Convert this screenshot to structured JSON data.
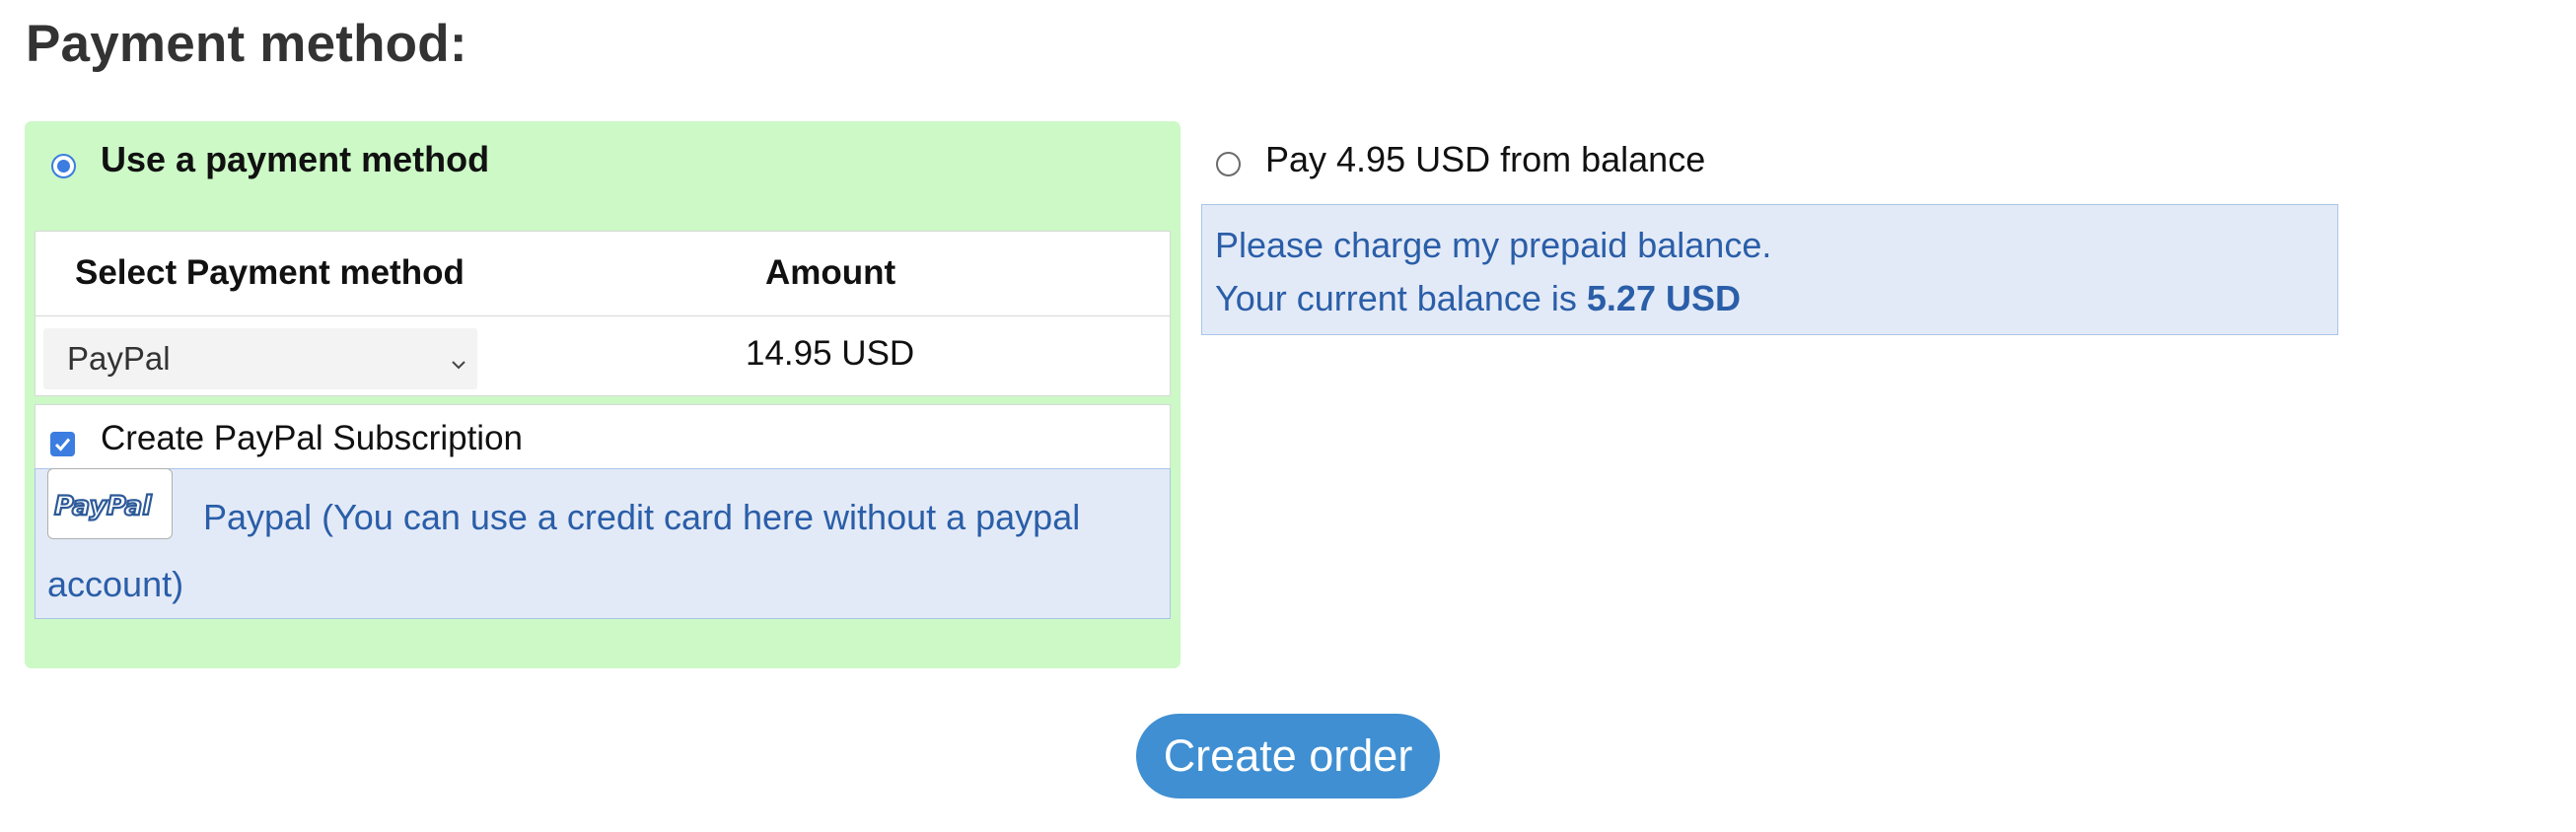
{
  "page": {
    "title": "Payment method:"
  },
  "payment_option": {
    "label": "Use a payment method",
    "selected": true
  },
  "method_table": {
    "header_method": "Select Payment method",
    "header_amount": "Amount",
    "selected_method": "PayPal",
    "amount": "14.95 USD"
  },
  "subscription": {
    "label": "Create PayPal Subscription",
    "checked": true
  },
  "paypal_info": {
    "logo_text": "PayPal",
    "text_line1": "Paypal (You can use a credit card here without a paypal",
    "text_line2": "account)"
  },
  "balance_option": {
    "label": "Pay 4.95 USD from balance",
    "selected": false,
    "info_line1": "Please charge my prepaid balance.",
    "info_line2_prefix": "Your current balance is ",
    "current_balance": "5.27 USD"
  },
  "actions": {
    "create_order_label": "Create order"
  },
  "colors": {
    "panel_green": "#ccf9c6",
    "info_blue_bg": "#e3eaf7",
    "info_blue_text": "#2a5ea8",
    "button_blue": "#3f8fd2",
    "radio_accent": "#3b7de0"
  }
}
